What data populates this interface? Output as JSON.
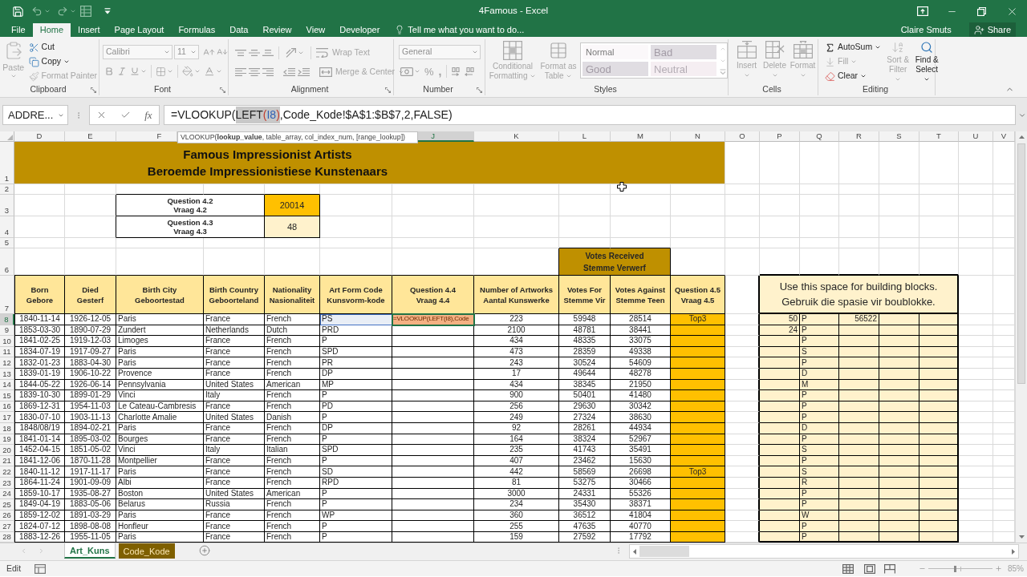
{
  "title_bar": {
    "title": "4Famous - Excel"
  },
  "ribbon_tabs": [
    {
      "label": "File",
      "selected": false
    },
    {
      "label": "Home",
      "selected": true
    },
    {
      "label": "Insert",
      "selected": false
    },
    {
      "label": "Page Layout",
      "selected": false
    },
    {
      "label": "Formulas",
      "selected": false
    },
    {
      "label": "Data",
      "selected": false
    },
    {
      "label": "Review",
      "selected": false
    },
    {
      "label": "View",
      "selected": false
    },
    {
      "label": "Developer",
      "selected": false
    }
  ],
  "tell_me": {
    "placeholder": "Tell me what you want to do..."
  },
  "account": {
    "user": "Claire Smuts",
    "share": "Share"
  },
  "ribbon": {
    "clipboard": {
      "label": "Clipboard",
      "paste": {
        "label": "Paste",
        "disabled": true
      },
      "cut": {
        "label": "Cut",
        "disabled": false
      },
      "copy": {
        "label": "Copy",
        "disabled": false
      },
      "format_painter": {
        "label": "Format Painter",
        "disabled": true
      }
    },
    "font": {
      "label": "Font",
      "font_name": {
        "value": "Calibri",
        "disabled": true
      },
      "font_size": {
        "value": "11",
        "disabled": true
      }
    },
    "alignment": {
      "label": "Alignment",
      "wrap_text": {
        "label": "Wrap Text",
        "disabled": true
      },
      "merge_center": {
        "label": "Merge & Center",
        "disabled": true
      }
    },
    "number": {
      "label": "Number",
      "format": {
        "value": "General",
        "disabled": true
      },
      "percent": "%",
      "comma": ","
    },
    "styles": {
      "label": "Styles",
      "conditional_formatting": {
        "label": "Conditional Formatting",
        "disabled": true
      },
      "format_as_table": {
        "label": "Format as Table",
        "disabled": true
      },
      "gallery": [
        {
          "label": "Normal",
          "kind": "normal"
        },
        {
          "label": "Bad",
          "kind": "bad"
        },
        {
          "label": "Good",
          "kind": "good"
        },
        {
          "label": "Neutral",
          "kind": "neutral"
        }
      ]
    },
    "cells": {
      "label": "Cells",
      "items": [
        {
          "label": "Insert",
          "disabled": true
        },
        {
          "label": "Delete",
          "disabled": true
        },
        {
          "label": "Format",
          "disabled": true
        }
      ]
    },
    "editing": {
      "label": "Editing",
      "autosum": {
        "label": "AutoSum",
        "disabled": false
      },
      "fill": {
        "label": "Fill",
        "disabled": true
      },
      "clear": {
        "label": "Clear",
        "disabled": false
      },
      "sort_filter": {
        "label": "Sort & Filter",
        "disabled": true
      },
      "find_select": {
        "label": "Find & Select",
        "disabled": false
      }
    }
  },
  "formula_bar": {
    "name_box": "ADDRE...",
    "insert_function": "fx",
    "formula": [
      {
        "text": "=VLOOKUP(",
        "kind": "text",
        "selected": false
      },
      {
        "text": "LEFT",
        "kind": "text",
        "selected": true
      },
      {
        "text": "(",
        "kind": "paren",
        "selected": true
      },
      {
        "text": "I8",
        "kind": "reference",
        "selected": true
      },
      {
        "text": ")",
        "kind": "paren",
        "selected": true
      },
      {
        "text": ",Code_Kode!$A$1:$B$7,2,FALSE)",
        "kind": "text",
        "selected": false
      }
    ],
    "tooltip": "VLOOKUP(**lookup_value**, table_array, col_index_num, [range_lookup])"
  },
  "sheet": {
    "columns_left": [
      {
        "label": "D",
        "selected": false
      },
      {
        "label": "E",
        "selected": false
      },
      {
        "label": "F",
        "selected": false
      }
    ],
    "columns_right": [
      {
        "label": "J",
        "selected": true
      },
      {
        "label": "K",
        "selected": false
      },
      {
        "label": "L",
        "selected": false
      },
      {
        "label": "M",
        "selected": false
      },
      {
        "label": "N",
        "selected": false
      },
      {
        "label": "O",
        "selected": false
      },
      {
        "label": "P",
        "selected": false
      },
      {
        "label": "Q",
        "selected": false
      },
      {
        "label": "R",
        "selected": false
      },
      {
        "label": "S",
        "selected": false
      },
      {
        "label": "T",
        "selected": false
      },
      {
        "label": "U",
        "selected": false
      },
      {
        "label": "V",
        "selected": false
      }
    ],
    "row_numbers": [
      {
        "label": "1",
        "selected": false
      },
      {
        "label": "2",
        "selected": false
      },
      {
        "label": "3",
        "selected": false
      },
      {
        "label": "4",
        "selected": false
      },
      {
        "label": "5",
        "selected": false
      },
      {
        "label": "6",
        "selected": false
      },
      {
        "label": "7",
        "selected": false
      },
      {
        "label": "8",
        "selected": true
      },
      {
        "label": "9",
        "selected": false
      },
      {
        "label": "10",
        "selected": false
      },
      {
        "label": "11",
        "selected": false
      },
      {
        "label": "12",
        "selected": false
      },
      {
        "label": "13",
        "selected": false
      },
      {
        "label": "14",
        "selected": false
      },
      {
        "label": "15",
        "selected": false
      },
      {
        "label": "16",
        "selected": false
      },
      {
        "label": "17",
        "selected": false
      },
      {
        "label": "18",
        "selected": false
      },
      {
        "label": "19",
        "selected": false
      },
      {
        "label": "20",
        "selected": false
      },
      {
        "label": "21",
        "selected": false
      },
      {
        "label": "22",
        "selected": false
      },
      {
        "label": "23",
        "selected": false
      },
      {
        "label": "24",
        "selected": false
      },
      {
        "label": "25",
        "selected": false
      },
      {
        "label": "26",
        "selected": false
      },
      {
        "label": "27",
        "selected": false
      },
      {
        "label": "28",
        "selected": false
      }
    ],
    "title": "Famous Impressionist Artists\nBeroemde Impressionistiese Kunstenaars",
    "questions": [
      {
        "label": "Question 4.2\nVraag 4.2",
        "value": "20014",
        "color": "#ffc000"
      },
      {
        "label": "Question 4.3\nVraag 4.3",
        "value": "48",
        "color": "#fff2cc"
      }
    ],
    "votes_group": "Votes Received\nStemme Verwerf",
    "headers": [
      "Born\nGebore",
      "Died\nGesterf",
      "Birth City\nGeboortestad",
      "Birth Country\nGeboorteland",
      "Nationality\nNasionaliteit",
      "Art Form Code\nKunsvorm-kode",
      "Question 4.4\nVraag 4.4",
      "Number of Artworks\nAantal Kunswerke",
      "Votes For\nStemme Vir",
      "Votes Against\nStemme Teen",
      "Question 4.5\nVraag 4.5"
    ],
    "notes": "Use this space for building blocks.\nGebruik die spasie vir boublokke.",
    "rows": [
      {
        "born": "1840-11-14",
        "died": "1926-12-05",
        "birth_city": "Paris",
        "birth_country": "France",
        "nationality": "French",
        "art_form_code": "PS",
        "question_4_4": "=VLOOKUP(LEFT(I8),Code",
        "artworks": "223",
        "votes_for": "59948",
        "votes_against": "28514",
        "question_4_5": "Top3",
        "block_p": "50",
        "block_q": "P",
        "block_r": "56522"
      },
      {
        "born": "1853-03-30",
        "died": "1890-07-29",
        "birth_city": "Zundert",
        "birth_country": "Netherlands",
        "nationality": "Dutch",
        "art_form_code": "PRD",
        "artworks": "2100",
        "votes_for": "48781",
        "votes_against": "38441",
        "block_p": "24",
        "block_q": "P"
      },
      {
        "born": "1841-02-25",
        "died": "1919-12-03",
        "birth_city": "Limoges",
        "birth_country": "France",
        "nationality": "French",
        "art_form_code": "P",
        "artworks": "434",
        "votes_for": "48335",
        "votes_against": "33075",
        "block_q": "P"
      },
      {
        "born": "1834-07-19",
        "died": "1917-09-27",
        "birth_city": "Paris",
        "birth_country": "France",
        "nationality": "French",
        "art_form_code": "SPD",
        "artworks": "473",
        "votes_for": "28359",
        "votes_against": "49338",
        "block_q": "S"
      },
      {
        "born": "1832-01-23",
        "died": "1883-04-30",
        "birth_city": "Paris",
        "birth_country": "France",
        "nationality": "French",
        "art_form_code": "PR",
        "artworks": "243",
        "votes_for": "30524",
        "votes_against": "54609",
        "block_q": "P"
      },
      {
        "born": "1839-01-19",
        "died": "1906-10-22",
        "birth_city": "Provence",
        "birth_country": "France",
        "nationality": "French",
        "art_form_code": "DP",
        "artworks": "17",
        "votes_for": "49644",
        "votes_against": "48278",
        "block_q": "D"
      },
      {
        "born": "1844-05-22",
        "died": "1926-06-14",
        "birth_city": "Pennsylvania",
        "birth_country": "United States",
        "nationality": "American",
        "art_form_code": "MP",
        "artworks": "434",
        "votes_for": "38345",
        "votes_against": "21950",
        "block_q": "M"
      },
      {
        "born": "1839-10-30",
        "died": "1899-01-29",
        "birth_city": "Vinci",
        "birth_country": "Italy",
        "nationality": "French",
        "art_form_code": "P",
        "artworks": "900",
        "votes_for": "50401",
        "votes_against": "41480",
        "block_q": "P"
      },
      {
        "born": "1869-12-31",
        "died": "1954-11-03",
        "birth_city": "Le Cateau-Cambresis",
        "birth_country": "France",
        "nationality": "French",
        "art_form_code": "PD",
        "artworks": "256",
        "votes_for": "29630",
        "votes_against": "30342",
        "block_q": "P"
      },
      {
        "born": "1830-07-10",
        "died": "1903-11-13",
        "birth_city": "Charlotte Amalie",
        "birth_country": "United States",
        "nationality": "Danish",
        "art_form_code": "P",
        "artworks": "249",
        "votes_for": "27324",
        "votes_against": "38630",
        "block_q": "P"
      },
      {
        "born": "1848/08/19",
        "died": "1894-02-21",
        "birth_city": "Paris",
        "birth_country": "France",
        "nationality": "French",
        "art_form_code": "DP",
        "artworks": "92",
        "votes_for": "28261",
        "votes_against": "44934",
        "block_q": "D"
      },
      {
        "born": "1841-01-14",
        "died": "1895-03-02",
        "birth_city": "Bourges",
        "birth_country": "France",
        "nationality": "French",
        "art_form_code": "P",
        "artworks": "164",
        "votes_for": "38324",
        "votes_against": "52967",
        "block_q": "P"
      },
      {
        "born": "1452-04-15",
        "died": "1851-05-02",
        "birth_city": "Vinci",
        "birth_country": "Italy",
        "nationality": "Italian",
        "art_form_code": "SPD",
        "artworks": "235",
        "votes_for": "41743",
        "votes_against": "35491",
        "block_q": "S"
      },
      {
        "born": "1841-12-06",
        "died": "1870-11-28",
        "birth_city": "Montpellier",
        "birth_country": "France",
        "nationality": "French",
        "art_form_code": "P",
        "artworks": "407",
        "votes_for": "23462",
        "votes_against": "15630",
        "block_q": "P"
      },
      {
        "born": "1840-11-12",
        "died": "1917-11-17",
        "birth_city": "Paris",
        "birth_country": "France",
        "nationality": "French",
        "art_form_code": "SD",
        "artworks": "442",
        "votes_for": "58569",
        "votes_against": "26698",
        "question_4_5": "Top3",
        "block_q": "S"
      },
      {
        "born": "1864-11-24",
        "died": "1901-09-09",
        "birth_city": "Albi",
        "birth_country": "France",
        "nationality": "French",
        "art_form_code": "RPD",
        "artworks": "81",
        "votes_for": "53275",
        "votes_against": "30466",
        "block_q": "R"
      },
      {
        "born": "1859-10-17",
        "died": "1935-08-27",
        "birth_city": "Boston",
        "birth_country": "United States",
        "nationality": "American",
        "art_form_code": "P",
        "artworks": "3000",
        "votes_for": "24331",
        "votes_against": "55326",
        "block_q": "P"
      },
      {
        "born": "1849-04-19",
        "died": "1883-05-06",
        "birth_city": "Belarus",
        "birth_country": "Russia",
        "nationality": "French",
        "art_form_code": "P",
        "artworks": "234",
        "votes_for": "35430",
        "votes_against": "38371",
        "block_q": "P"
      },
      {
        "born": "1859-12-02",
        "died": "1891-03-29",
        "birth_city": "Paris",
        "birth_country": "France",
        "nationality": "French",
        "art_form_code": "WP",
        "artworks": "360",
        "votes_for": "36512",
        "votes_against": "41804",
        "block_q": "W"
      },
      {
        "born": "1824-07-12",
        "died": "1898-08-08",
        "birth_city": "Honfleur",
        "birth_country": "France",
        "nationality": "French",
        "art_form_code": "P",
        "artworks": "255",
        "votes_for": "47635",
        "votes_against": "40770",
        "block_q": "P"
      },
      {
        "born": "1883-12-26",
        "died": "1955-11-05",
        "birth_city": "Paris",
        "birth_country": "France",
        "nationality": "French",
        "art_form_code": "P",
        "artworks": "159",
        "votes_for": "27592",
        "votes_against": "17792",
        "block_q": "P"
      }
    ]
  },
  "sheet_tabs": [
    {
      "label": "Art_Kuns",
      "selected": true
    },
    {
      "label": "Code_Kode",
      "selected": false,
      "color": "#7f6000"
    }
  ],
  "status_bar": {
    "mode": "Edit",
    "zoom": {
      "level": 0.42,
      "reading": "85%"
    }
  }
}
